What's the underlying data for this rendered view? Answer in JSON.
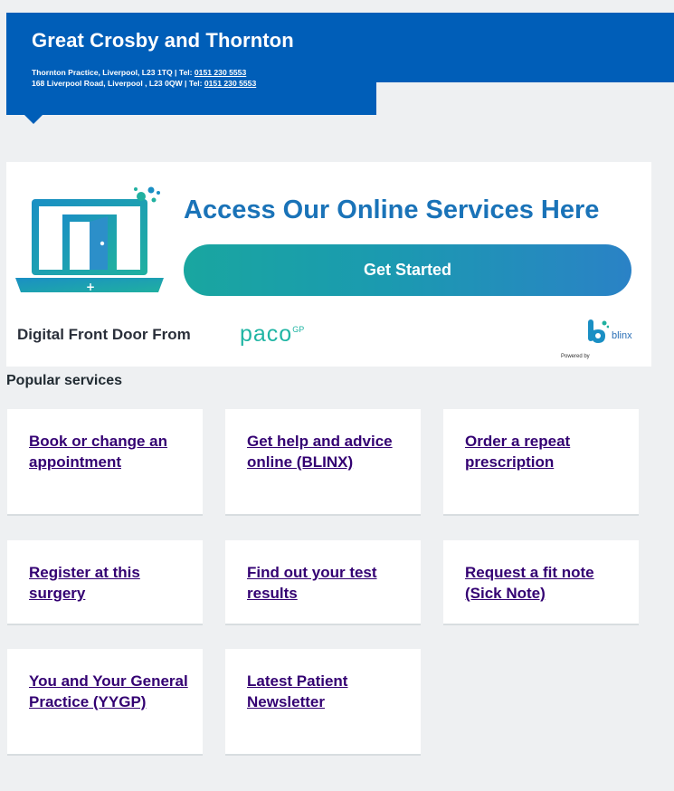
{
  "header": {
    "title": "Great Crosby and Thornton",
    "address_line_1": "Thornton Practice, Liverpool, L23 1TQ | Tel: ",
    "phone_1": "0151 230 5553",
    "address_line_2": "168 Liverpool Road, Liverpool , L23 0QW | Tel: ",
    "phone_2": "0151 230 5553"
  },
  "banner": {
    "heading": "Access Our Online Services Here",
    "cta_label": "Get Started",
    "footer_text": "Digital Front Door From",
    "paco_logo": "paco",
    "paco_sup": "GP",
    "powered_by": "Powered by",
    "blinx_logo": "blinx"
  },
  "popular_services": {
    "title": "Popular services",
    "cards": [
      {
        "label": "Book or change an appointment"
      },
      {
        "label": "Get help and advice online (BLINX)"
      },
      {
        "label": "Order a repeat prescription"
      },
      {
        "label": "Register at this surgery"
      },
      {
        "label": "Find out your test results"
      },
      {
        "label": "Request a fit note (Sick Note)"
      },
      {
        "label": "You and Your General Practice (YYGP)"
      },
      {
        "label": "Latest Patient Newsletter"
      }
    ]
  },
  "colors": {
    "header_blue": "#005eb8",
    "link_purple": "#330072",
    "heading_blue": "#1a73b8",
    "teal": "#1aa6a0",
    "page_bg": "#eef0f2"
  }
}
